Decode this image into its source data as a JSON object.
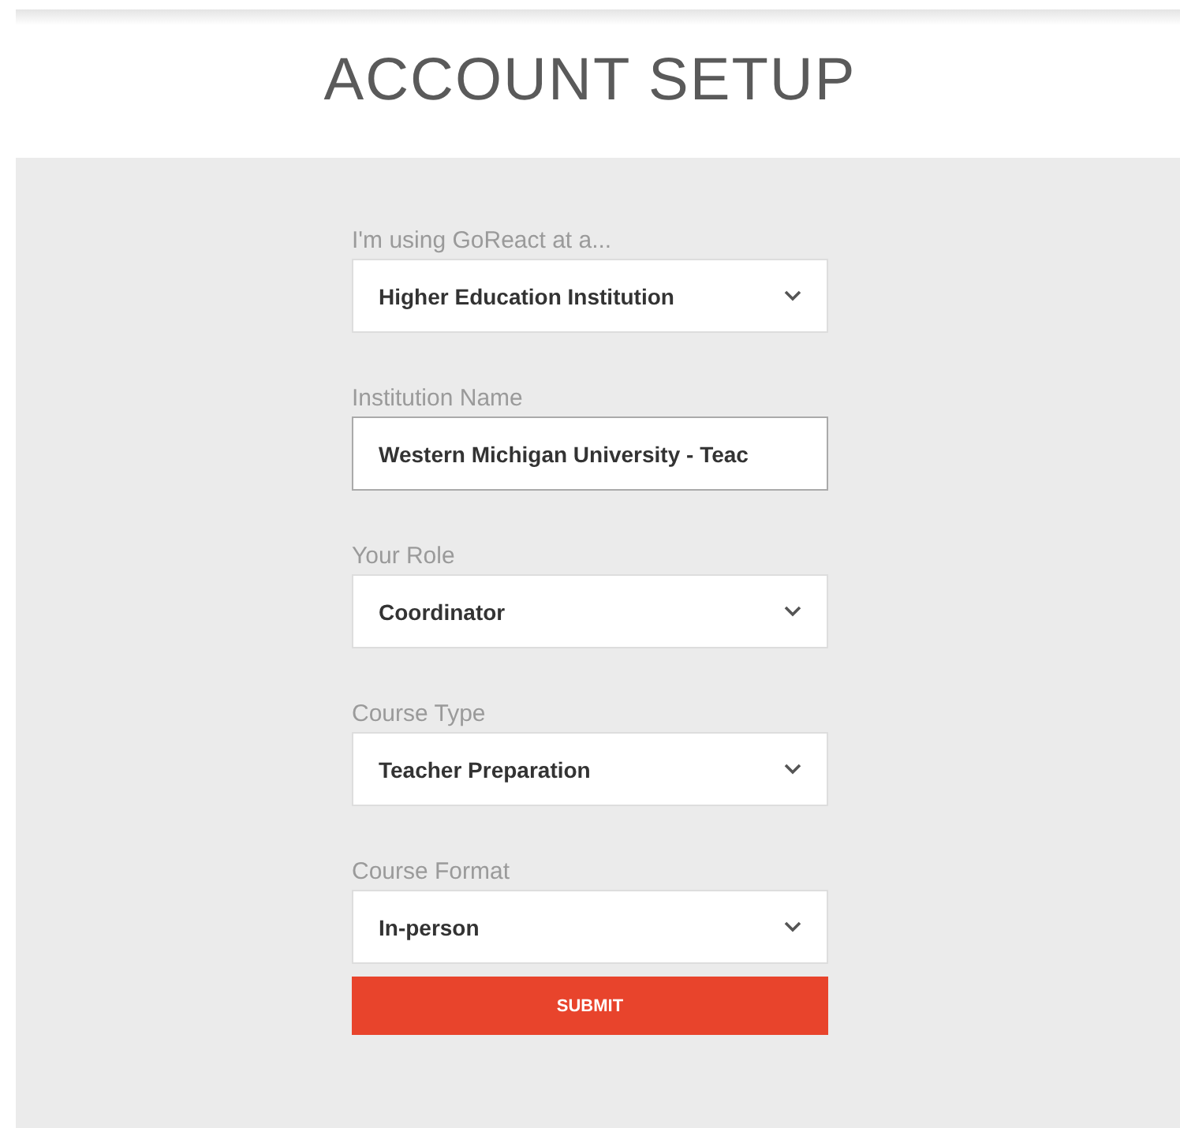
{
  "title": "ACCOUNT SETUP",
  "fields": [
    {
      "label": "I'm using GoReact at a...",
      "kind": "select",
      "value": "Higher Education Institution"
    },
    {
      "label": "Institution Name",
      "kind": "text",
      "value": "Western Michigan University - Teac"
    },
    {
      "label": "Your Role",
      "kind": "select",
      "value": "Coordinator"
    },
    {
      "label": "Course Type",
      "kind": "select",
      "value": "Teacher Preparation"
    },
    {
      "label": "Course Format",
      "kind": "select",
      "value": "In-person"
    }
  ],
  "submit": "SUBMIT"
}
